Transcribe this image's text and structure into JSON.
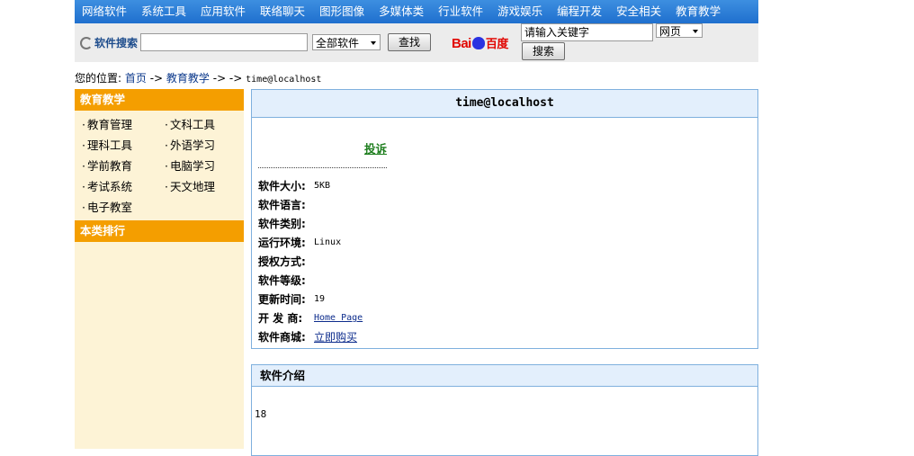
{
  "nav": {
    "items": [
      "网络软件",
      "系统工具",
      "应用软件",
      "联络聊天",
      "图形图像",
      "多媒体类",
      "行业软件",
      "游戏娱乐",
      "编程开发",
      "安全相关",
      "教育教学"
    ]
  },
  "search": {
    "label": "软件搜索",
    "input_value": "",
    "category_selected": "全部软件",
    "button": "查找"
  },
  "baidu": {
    "logo_left": "Bai",
    "logo_right": "百度",
    "input_value": "请输入关键字",
    "select_selected": "网页",
    "button": "搜索"
  },
  "breadcrumb": {
    "prefix": "您的位置:",
    "home": "首页",
    "sep1": " -> ",
    "category": "教育教学",
    "sep2": " -> -> ",
    "current": "time@localhost"
  },
  "sidebar": {
    "category_title": "教育教学",
    "items": [
      "教育管理",
      "文科工具",
      "理科工具",
      "外语学习",
      "学前教育",
      "电脑学习",
      "考试系统",
      "天文地理",
      "电子教室"
    ],
    "ranking_title": "本类排行"
  },
  "detail": {
    "title": "time@localhost",
    "complain": "投诉",
    "rows": [
      {
        "k": "软件大小:",
        "v": "5KB"
      },
      {
        "k": "软件语言:",
        "v": ""
      },
      {
        "k": "软件类别:",
        "v": ""
      },
      {
        "k": "运行环境:",
        "v": "Linux"
      },
      {
        "k": "授权方式:",
        "v": ""
      },
      {
        "k": "软件等级:",
        "v": ""
      },
      {
        "k": "更新时间:",
        "v": "19"
      },
      {
        "k": "开 发 商:",
        "v": "Home Page"
      },
      {
        "k": "软件商城:",
        "v": "立即购买"
      }
    ]
  },
  "intro": {
    "title": "软件介绍",
    "text": "18"
  },
  "colors": {
    "nav_bg": "#1f6fce",
    "sidebar_header": "#f49e00",
    "sidebar_bg": "#fdf3d6",
    "box_border": "#7fb0de",
    "box_header_bg": "#e3effc",
    "complain_green": "#1e7e1e"
  }
}
